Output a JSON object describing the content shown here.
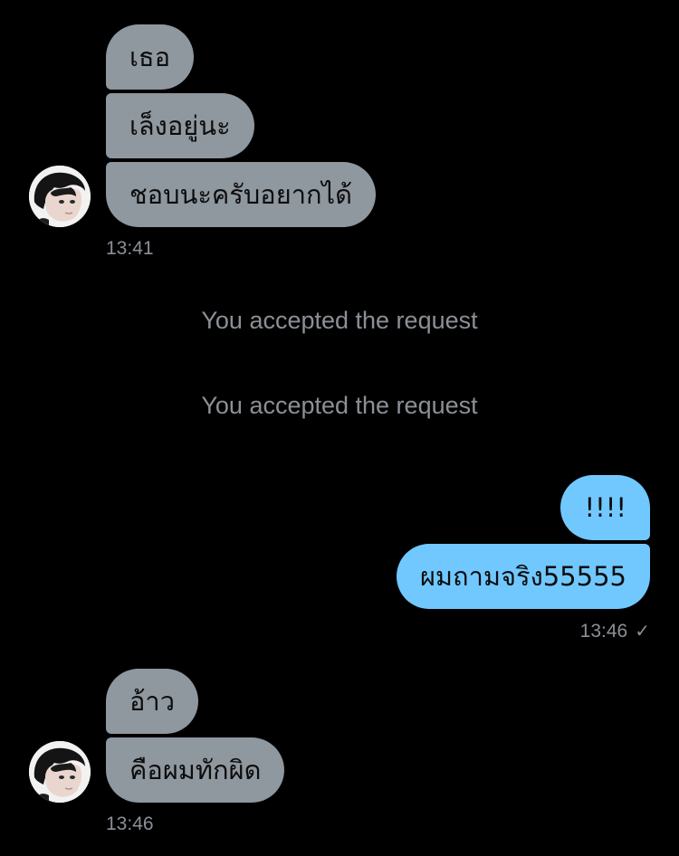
{
  "group1": {
    "messages": [
      "เธอ",
      "เล็งอยู่นะ",
      "ชอบนะครับอยากได้"
    ],
    "time": "13:41"
  },
  "system_notices": [
    "You accepted the request",
    "You accepted the request"
  ],
  "group2": {
    "messages": [
      "!!!!",
      "ผมถามจริง55555"
    ],
    "time": "13:46"
  },
  "group3": {
    "messages": [
      "อ้าว",
      "คือผมทักผิด"
    ],
    "time": "13:46"
  },
  "colors": {
    "background": "#000000",
    "incoming_bubble": "#8f979f",
    "outgoing_bubble": "#71c8ff",
    "meta_text": "#8b9096"
  },
  "icons": {
    "avatar": "avatar-photo",
    "read_receipt": "checkmark-icon"
  }
}
